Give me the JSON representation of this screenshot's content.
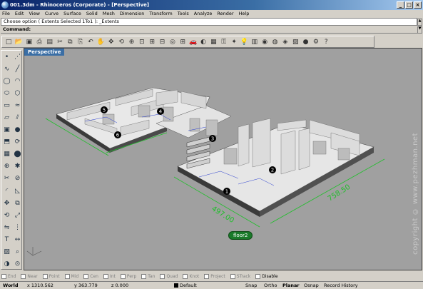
{
  "window": {
    "title": "001.3dm - Rhinoceros (Corporate) - [Perspective]",
    "controls": [
      "_",
      "□",
      "×"
    ]
  },
  "menu": [
    "File",
    "Edit",
    "View",
    "Curve",
    "Surface",
    "Solid",
    "Mesh",
    "Dimension",
    "Transform",
    "Tools",
    "Analyze",
    "Render",
    "Help"
  ],
  "command": {
    "history": "Choose option ( Extents  Selected  1To1 ): _Extents",
    "prompt": "Command:"
  },
  "toolbar_icons": [
    "new-icon",
    "open-icon",
    "save-icon",
    "print-icon",
    "import-icon",
    "cut-icon",
    "copy-icon",
    "paste-icon",
    "undo-icon",
    "hand-icon",
    "pan-icon",
    "rotate-icon",
    "zoom-icon",
    "zoom-window-icon",
    "zoom-extents-icon",
    "zoom-selected-icon",
    "zoom-target-icon",
    "four-views-icon",
    "car-icon",
    "camera-icon",
    "grid-icon",
    "lock-icon",
    "light-icon",
    "bulb-icon",
    "layer-icon",
    "color-icon",
    "render-icon",
    "material-icon",
    "texture-icon",
    "sphere-icon",
    "options-icon",
    "help-icon",
    "blank-icon",
    "blank2-icon",
    "blank3-icon",
    "blank4-icon"
  ],
  "toolbar_glyphs": [
    "□",
    "📂",
    "▣",
    "⎙",
    "▤",
    "✂",
    "⧉",
    "⎘",
    "↶",
    "✋",
    "✥",
    "⟲",
    "⊕",
    "⊡",
    "⊞",
    "⊟",
    "◎",
    "⊞",
    "🚗",
    "◐",
    "▦",
    "⚿",
    "✦",
    "💡",
    "▥",
    "◉",
    "◍",
    "◈",
    "▧",
    "●",
    "⚙",
    "?",
    "",
    "",
    "",
    ""
  ],
  "left_tools": [
    "point-icon",
    "polyline-icon",
    "curve-icon",
    "line-icon",
    "circle-icon",
    "arc-icon",
    "ellipse-icon",
    "polygon-icon",
    "rectangle-icon",
    "freeform-icon",
    "surface-icon",
    "loft-icon",
    "box-icon",
    "sphere-icon",
    "extrude-icon",
    "revolve-icon",
    "mesh-icon",
    "cylinder-icon",
    "join-icon",
    "explode-icon",
    "trim-icon",
    "split-icon",
    "fillet-icon",
    "chamfer-icon",
    "move-icon",
    "copy-icon",
    "rotate-icon",
    "scale-icon",
    "mirror-icon",
    "array-icon",
    "text-icon",
    "dimension-icon",
    "hatch-icon",
    "analyze-icon",
    "render-icon",
    "osnap-icon"
  ],
  "left_glyphs": [
    "•",
    "⋰",
    "∿",
    "╱",
    "◯",
    "◠",
    "⬭",
    "⬡",
    "▭",
    "≈",
    "▱",
    "⫽",
    "▣",
    "●",
    "⬒",
    "⟳",
    "▦",
    "⬤",
    "⊕",
    "✱",
    "✂",
    "⊘",
    "◜",
    "◺",
    "✥",
    "⧉",
    "⟲",
    "⤢",
    "⇋",
    "⋮",
    "T",
    "↔",
    "▨",
    "⌕",
    "◑",
    "⊙"
  ],
  "viewport": {
    "label": "Perspective",
    "watermark": "copyright © www.pezhman.net",
    "floor_tag": "floor2",
    "dim_labels": [
      "497.00",
      "758.50"
    ],
    "markers": [
      "1",
      "2",
      "3",
      "4",
      "5",
      "6"
    ]
  },
  "osnaps": [
    {
      "label": "End",
      "on": false
    },
    {
      "label": "Near",
      "on": false
    },
    {
      "label": "Point",
      "on": false
    },
    {
      "label": "Mid",
      "on": false
    },
    {
      "label": "Cen",
      "on": false
    },
    {
      "label": "Int",
      "on": false
    },
    {
      "label": "Perp",
      "on": false
    },
    {
      "label": "Tan",
      "on": false
    },
    {
      "label": "Quad",
      "on": false
    },
    {
      "label": "Knot",
      "on": false
    },
    {
      "label": "Project",
      "on": false
    },
    {
      "label": "STrack",
      "on": false
    },
    {
      "label": "Disable",
      "on": true
    }
  ],
  "status": {
    "cplane": "World",
    "x": "x 1310.562",
    "y": "y 363.779",
    "z": "z 0.000",
    "layer": "Default",
    "snap": "Snap",
    "ortho": "Ortho",
    "planar": "Planar",
    "osnap": "Osnap",
    "record_history": "Record History"
  },
  "colors": {
    "title_start": "#0a246a",
    "viewport_bg": "#a0a0a0",
    "dim_green": "#1fbf2a",
    "floor_tag": "#1a7a2a"
  }
}
